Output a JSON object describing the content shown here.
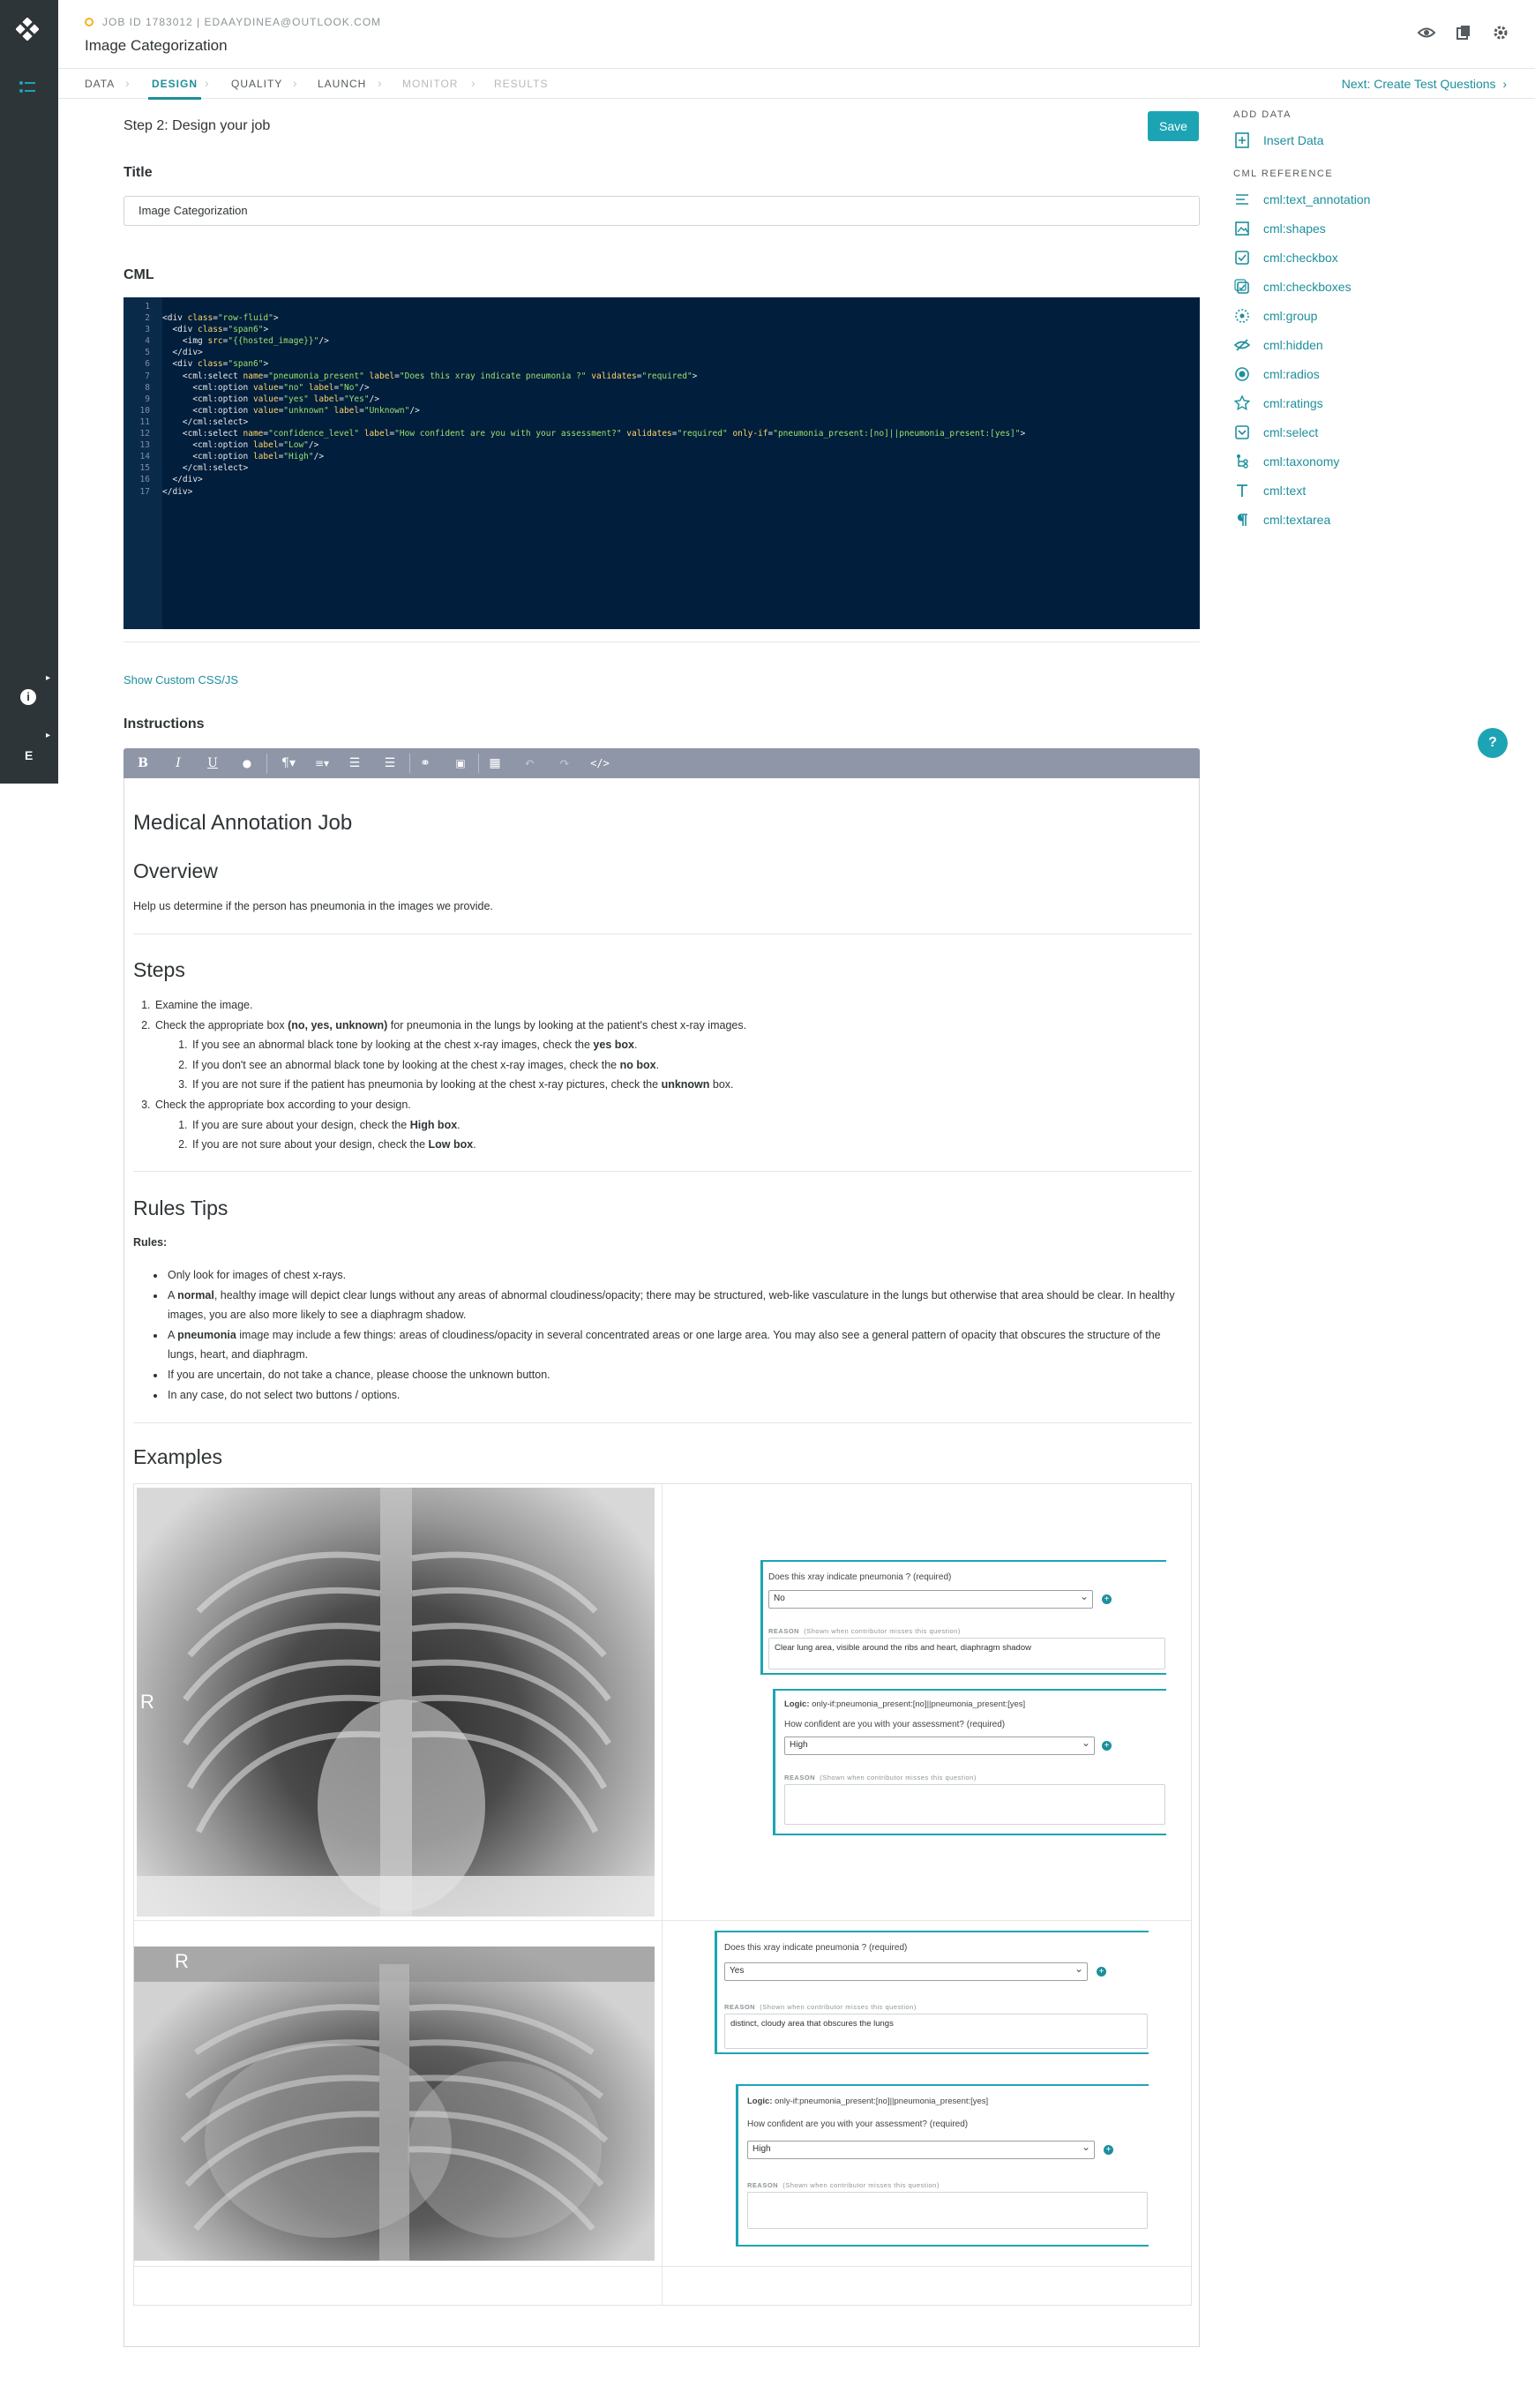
{
  "header": {
    "job_id": "JOB ID 1783012 | EDAAYDINEA@OUTLOOK.COM",
    "title": "Image Categorization"
  },
  "rail": {
    "letter": "E"
  },
  "tabs": [
    {
      "label": "DATA",
      "state": "normal"
    },
    {
      "label": "DESIGN",
      "state": "active"
    },
    {
      "label": "QUALITY",
      "state": "normal"
    },
    {
      "label": "LAUNCH",
      "state": "normal"
    },
    {
      "label": "MONITOR",
      "state": "disabled"
    },
    {
      "label": "RESULTS",
      "state": "disabled"
    }
  ],
  "next_link": "Next: Create Test Questions",
  "main": {
    "step_title": "Step 2: Design your job",
    "save_label": "Save",
    "title_label": "Title",
    "title_value": "Image Categorization",
    "cml_label": "CML",
    "show_css": "Show Custom CSS/JS",
    "instructions_label": "Instructions"
  },
  "code_lines": [
    "",
    "<div class=\"row-fluid\">",
    "  <div class=\"span6\">",
    "    <img src=\"{{hosted_image}}\"/>",
    "  </div>",
    "  <div class=\"span6\">",
    "    <cml:select name=\"pneumonia_present\" label=\"Does this xray indicate pneumonia ?\" validates=\"required\">",
    "      <cml:option value=\"no\" label=\"No\"/>",
    "      <cml:option value=\"yes\" label=\"Yes\"/>",
    "      <cml:option value=\"unknown\" label=\"Unknown\"/>",
    "    </cml:select>",
    "    <cml:select name=\"confidence_level\" label=\"How confident are you with your assessment?\" validates=\"required\" only-if=\"pneumonia_present:[no]||pneumonia_present:[yes]\">",
    "      <cml:option label=\"Low\"/>",
    "      <cml:option label=\"High\"/>",
    "    </cml:select>",
    "  </div>",
    "</div>"
  ],
  "doc": {
    "h_main": "Medical Annotation Job",
    "h_overview": "Overview",
    "overview_text": "Help us determine if the person has pneumonia in the images we provide.",
    "h_steps": "Steps",
    "steps": {
      "s1": "Examine the image.",
      "s2_pre": "Check the appropriate box ",
      "s2_bold": "(no, yes, unknown)",
      "s2_post": " for pneumonia in the lungs by looking at the patient's chest x-ray images.",
      "s2a_pre": "If you see an abnormal black tone by looking at the chest x-ray images, check the ",
      "s2a_bold": "yes box",
      "s2a_post": ".",
      "s2b_pre": "If you don't see an abnormal black tone by looking at the chest x-ray images, check the ",
      "s2b_bold": "no box",
      "s2b_post": ".",
      "s2c_pre": "If you are not sure if the patient has pneumonia by looking at the chest x-ray pictures, check the ",
      "s2c_bold": "unknown",
      "s2c_post": " box.",
      "s3": "Check the appropriate box according to your design.",
      "s3a_pre": "If you are sure about your design, check the ",
      "s3a_bold": "High box",
      "s3a_post": ".",
      "s3b_pre": "If you are not sure about your design, check the ",
      "s3b_bold": "Low box",
      "s3b_post": "."
    },
    "h_rules": "Rules Tips",
    "rules_label": "Rules:",
    "rules": {
      "r1": "Only look for images of chest x-rays.",
      "r2_pre": "A ",
      "r2_bold": "normal",
      "r2_post": ", healthy image will depict clear lungs without any areas of abnormal cloudiness/opacity; there may be structured, web-like vasculature in the lungs but otherwise that area should be clear. In healthy images, you are also more likely to see a diaphragm shadow.",
      "r3_pre": "A ",
      "r3_bold": "pneumonia",
      "r3_post": " image may include a few things: areas of cloudiness/opacity in several concentrated areas or one large area. You may also see a general pattern of opacity that obscures the structure of the lungs, heart, and diaphragm.",
      "r4": "If you are uncertain, do not take a chance, please choose the unknown button.",
      "r5": "In any case, do not select two buttons / options."
    },
    "h_examples": "Examples"
  },
  "examples": [
    {
      "marker": "R",
      "q1": "Does this xray indicate pneumonia ? (required)",
      "a1": "No",
      "reason_label": "REASON",
      "reason_hint": "(Shown when contributor misses this question)",
      "reason1": "Clear lung area, visible around the ribs and heart, diaphragm shadow",
      "logic_bold": "Logic:",
      "logic": " only-if:pneumonia_present:[no]||pneumonia_present:[yes]",
      "q2": "How confident are you with your assessment? (required)",
      "a2": "High",
      "reason2": ""
    },
    {
      "marker": "R",
      "q1": "Does this xray indicate pneumonia ? (required)",
      "a1": "Yes",
      "reason_label": "REASON",
      "reason_hint": "(Shown when contributor misses this question)",
      "reason1": "distinct, cloudy area that obscures the lungs",
      "logic_bold": "Logic:",
      "logic": " only-if:pneumonia_present:[no]||pneumonia_present:[yes]",
      "q2": "How confident are you with your assessment? (required)",
      "a2": "High",
      "reason2": ""
    }
  ],
  "right_panel": {
    "add_data_title": "ADD DATA",
    "insert_data": "Insert Data",
    "cml_ref_title": "CML REFERENCE",
    "items": [
      {
        "label": "cml:text_annotation",
        "icon": "text-annotation-icon"
      },
      {
        "label": "cml:shapes",
        "icon": "shapes-icon"
      },
      {
        "label": "cml:checkbox",
        "icon": "checkbox-icon"
      },
      {
        "label": "cml:checkboxes",
        "icon": "checkboxes-icon"
      },
      {
        "label": "cml:group",
        "icon": "group-icon"
      },
      {
        "label": "cml:hidden",
        "icon": "hidden-icon"
      },
      {
        "label": "cml:radios",
        "icon": "radios-icon"
      },
      {
        "label": "cml:ratings",
        "icon": "star-icon"
      },
      {
        "label": "cml:select",
        "icon": "select-icon"
      },
      {
        "label": "cml:taxonomy",
        "icon": "taxonomy-icon"
      },
      {
        "label": "cml:text",
        "icon": "text-icon"
      },
      {
        "label": "cml:textarea",
        "icon": "paragraph-icon"
      }
    ]
  },
  "help_label": "?",
  "colors": {
    "accent": "#1da4b4",
    "link": "#1d8f9c",
    "rail": "#2e3538",
    "code_bg": "#011e3c",
    "toolbar": "#8f96a8"
  }
}
